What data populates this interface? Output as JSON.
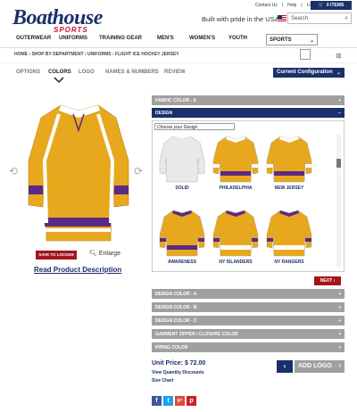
{
  "brand": {
    "name": "Boathouse",
    "sub": "SPORTS"
  },
  "top_links": [
    "Contact Us",
    "Help",
    "Login"
  ],
  "cart_label": "0 ITEMS",
  "tagline": "Built with pride in the USA",
  "search": {
    "placeholder": "Search"
  },
  "nav": [
    "OUTERWEAR",
    "UNIFORMS",
    "TRAINING GEAR",
    "MEN'S",
    "WOMEN'S",
    "YOUTH"
  ],
  "sport_select": "SPORTS",
  "breadcrumb": "HOME › SHOP BY DEPARTMENT › UNIFORMS › FLIGHT ICE HOCKEY JERSEY",
  "tabs": [
    "OPTIONS",
    "COLORS",
    "LOGO",
    "NAMES & NUMBERS",
    "REVIEW"
  ],
  "active_tab": "COLORS",
  "current_config": "Current Configuration",
  "accordion_top": [
    {
      "label": "FABRIC COLOR - A"
    },
    {
      "label": "DESIGN"
    }
  ],
  "choose_design": "Choose your Design",
  "designs": [
    {
      "label": "SOLID",
      "body": "#e9e9e9",
      "stripe": "#e9e9e9",
      "accent": "#e9e9e9"
    },
    {
      "label": "PHILADELPHIA",
      "body": "#e7a81e",
      "stripe": "#5b2a86",
      "accent": "#fff"
    },
    {
      "label": "NEW JERSEY",
      "body": "#e7a81e",
      "stripe": "#5b2a86",
      "accent": "#fff"
    },
    {
      "label": "AWARENESS",
      "body": "#e7a81e",
      "stripe": "#5b2a86",
      "accent": "#5b2a86"
    },
    {
      "label": "NY ISLANDERS",
      "body": "#e7a81e",
      "stripe": "#fff",
      "accent": "#5b2a86"
    },
    {
      "label": "NY RANGERS",
      "body": "#e7a81e",
      "stripe": "#fff",
      "accent": "#5b2a86"
    }
  ],
  "next_label": "NEXT ›",
  "accordion_bottom": [
    {
      "label": "DESIGN COLOR - A"
    },
    {
      "label": "DESIGN COLOR - B"
    },
    {
      "label": "DESIGN COLOR - C"
    },
    {
      "label": "GARMENT ZIPPER / CLOSURE COLOR"
    },
    {
      "label": "PIPING COLOR"
    }
  ],
  "save_label": "SAVE TO LOCKER",
  "enlarge_label": "Enlarge",
  "read_desc": "Read Product Description",
  "price": "Unit Price: $ 72.00",
  "qty_discounts": "View Quantity Discounts",
  "size_chart": "Size Chart",
  "add_logo": "ADD LOGO",
  "colors": {
    "navy": "#1b2f6b",
    "red": "#a3141c",
    "gold": "#e7a81e",
    "purple": "#5b2a86"
  }
}
